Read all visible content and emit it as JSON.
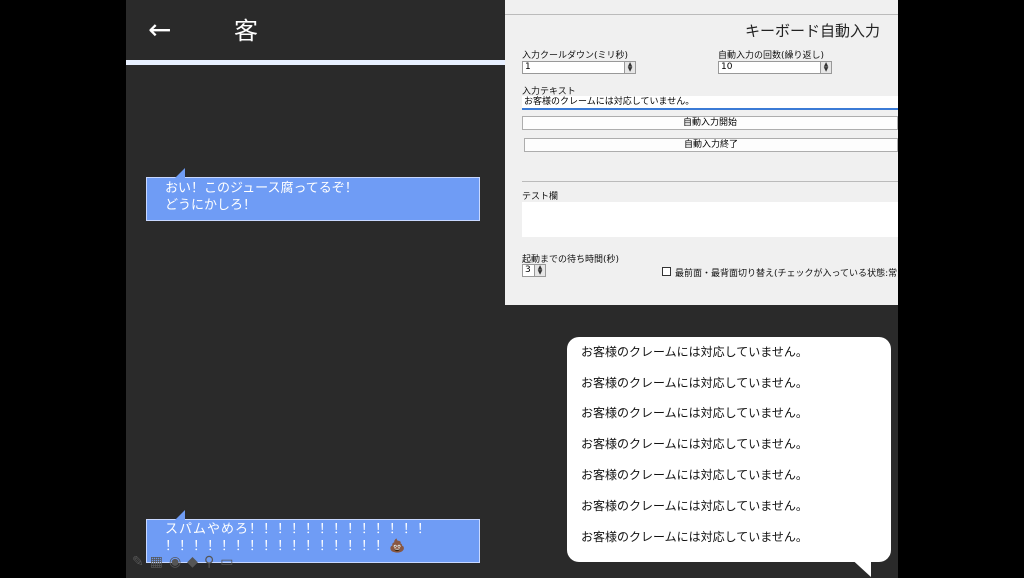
{
  "header": {
    "back_icon": "←",
    "title": "客"
  },
  "messages_left": [
    {
      "lines": [
        "おい！このジュース腐ってるぞ！",
        "どうにかしろ！"
      ]
    },
    {
      "lines": [
        "スパムやめろ！！！！！！！！！！！！！",
        "！！！！！！！！！！！！！！！！💩"
      ]
    }
  ],
  "toolbar_icons": [
    "pencil-icon",
    "image-icon",
    "camera-icon",
    "location-icon",
    "microphone-icon",
    "video-icon"
  ],
  "tool_glyphs": "✎▦◉◆⚲▭",
  "panel": {
    "title": "キーボード自動入力",
    "cooldown_label": "入力クールダウン(ミリ秒)",
    "cooldown_value": "1",
    "repeat_label": "自動入力の回数(繰り返し)",
    "repeat_value": "10",
    "text_label": "入力テキスト",
    "text_value": "お客様のクレームには対応していません。",
    "start_button": "自動入力開始",
    "stop_button": "自動入力終了",
    "test_label": "テスト欄",
    "wait_label": "起動までの待ち時間(秒)",
    "wait_value": "3",
    "topmost_label": "最前面・最背面切り替え(チェックが入っている状態:常に最前"
  },
  "reply": {
    "lines": [
      "お客様のクレームには対応していません。",
      "お客様のクレームには対応していません。",
      "お客様のクレームには対応していません。",
      "お客様のクレームには対応していません。",
      "お客様のクレームには対応していません。",
      "お客様のクレームには対応していません。",
      "お客様のクレームには対応していません。"
    ]
  },
  "colors": {
    "background": "#2a2a2a",
    "bubble_left": "#6f9cf5",
    "panel": "#f0f0f0",
    "focus": "#3b7bd6"
  }
}
